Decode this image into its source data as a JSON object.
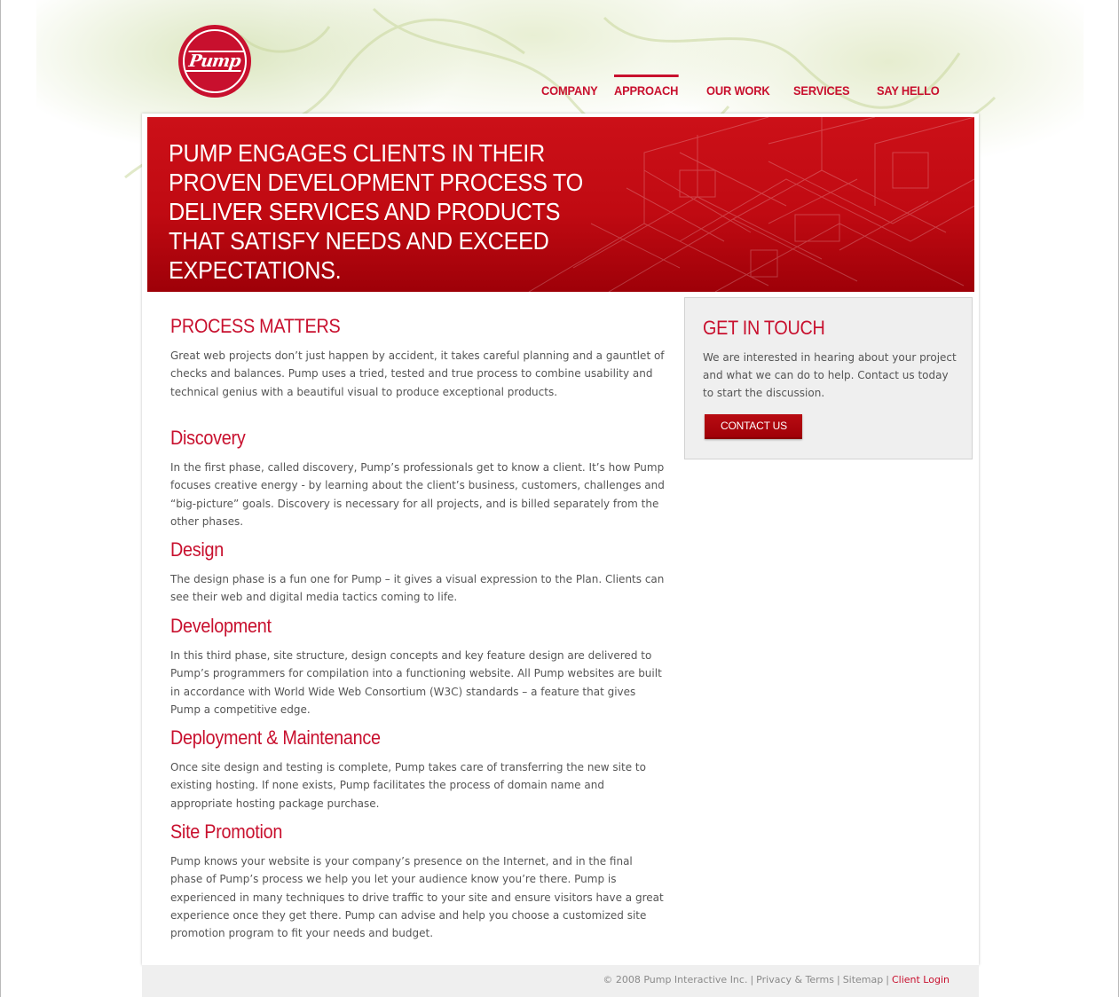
{
  "brand": {
    "logo_text": "Pump",
    "accent_color": "#c8102e"
  },
  "nav": {
    "items": [
      {
        "label": "COMPANY",
        "active": false
      },
      {
        "label": "APPROACH",
        "active": true
      },
      {
        "label": "OUR WORK",
        "active": false
      },
      {
        "label": "SERVICES",
        "active": false
      },
      {
        "label": "SAY HELLO",
        "active": false
      }
    ]
  },
  "banner": {
    "headline": "PUMP ENGAGES CLIENTS IN THEIR PROVEN DEVELOPMENT PROCESS TO DELIVER SERVICES AND PRODUCTS THAT SATISFY NEEDS AND EXCEED EXPECTATIONS."
  },
  "content": {
    "sections": [
      {
        "title": "PROCESS MATTERS",
        "body": "Great web projects don’t just happen by accident, it takes careful planning and a gauntlet of checks and balances. Pump uses a tried, tested and true process to combine usability and technical genius with a beautiful visual to produce exceptional products."
      },
      {
        "title": "Discovery",
        "body": "In the first phase, called discovery, Pump’s professionals get to know a client. It’s how Pump focuses creative energy - by learning about the client’s business, customers, challenges and “big-picture” goals. Discovery is necessary for all projects, and is billed separately from the other phases."
      },
      {
        "title": "Design",
        "body": "The design phase is a fun one for Pump – it gives a visual expression to the Plan. Clients can see their web and digital media tactics coming to life."
      },
      {
        "title": "Development",
        "body": "In this third phase, site structure, design concepts and key feature design are delivered to Pump’s programmers for compilation into a functioning website. All Pump websites are built in accordance with World Wide Web Consortium (W3C) standards – a feature that gives Pump a competitive edge."
      },
      {
        "title": "Deployment & Maintenance",
        "body": "Once site design and testing is complete, Pump takes care of transferring the new site to existing hosting. If none exists, Pump facilitates the process of domain name and appropriate hosting package purchase."
      },
      {
        "title": "Site Promotion",
        "body": "Pump knows your website is your company’s presence on the Internet, and in the final phase of Pump’s process we help you let your audience know you’re there. Pump is experienced in many techniques to drive traffic to your site and ensure visitors have a great experience once they get there. Pump can advise and help you choose a customized site promotion program to fit your needs and budget."
      }
    ]
  },
  "sidebar": {
    "title": "GET IN TOUCH",
    "body": "We are interested in hearing about your project and what we can do to help. Contact us today to start the discussion.",
    "button_label": "CONTACT US"
  },
  "footer": {
    "copyright": "© 2008 Pump Interactive Inc.",
    "links": [
      "Privacy & Terms",
      "Sitemap"
    ],
    "separator": "|",
    "client_login": "Client Login"
  }
}
